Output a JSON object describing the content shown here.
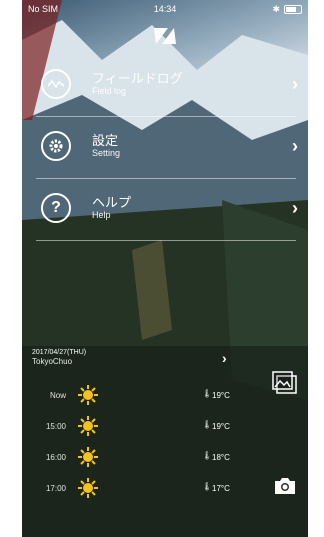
{
  "status": {
    "carrier": "No SIM",
    "time": "14:34"
  },
  "menu": [
    {
      "jp": "フィールドログ",
      "en": "Field log"
    },
    {
      "jp": "設定",
      "en": "Setting"
    },
    {
      "jp": "ヘルプ",
      "en": "Help"
    }
  ],
  "weather": {
    "date": "2017/04/27(THU)",
    "location": "TokyoChuo",
    "rows": [
      {
        "time": "Now",
        "temp": "19°C"
      },
      {
        "time": "15:00",
        "temp": "19°C"
      },
      {
        "time": "16:00",
        "temp": "18°C"
      },
      {
        "time": "17:00",
        "temp": "17°C"
      }
    ]
  },
  "colors": {
    "sun": "#f5c21b",
    "text": "#ffffff"
  },
  "icons": {
    "logo": "brand-logo-icon",
    "menu": [
      "chart-line-icon",
      "gear-icon",
      "question-icon"
    ],
    "gallery": "gallery-icon",
    "camera": "camera-icon"
  }
}
